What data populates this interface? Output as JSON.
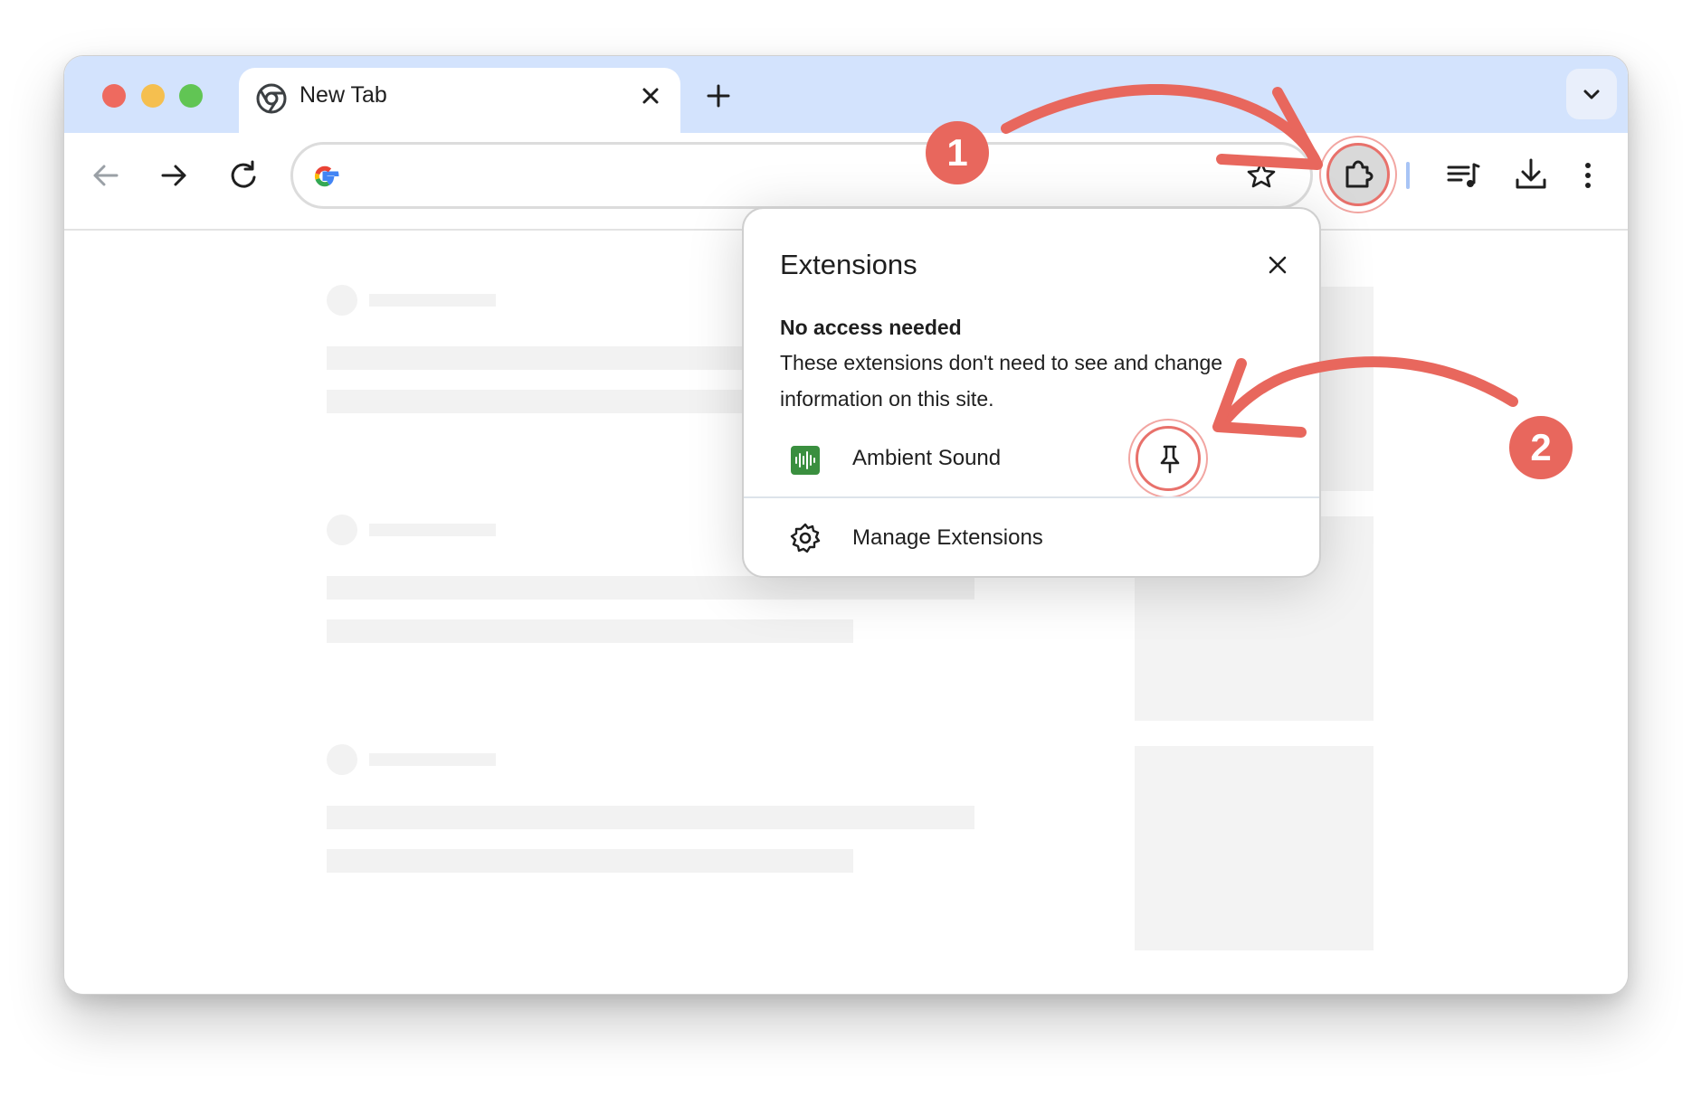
{
  "window": {
    "tab_title": "New Tab",
    "tab_icon": "chrome-icon"
  },
  "toolbar": {
    "back_icon": "arrow-left-icon",
    "forward_icon": "arrow-right-icon",
    "reload_icon": "reload-icon",
    "omnibox_icon": "google-g-icon",
    "bookmark_icon": "star-icon",
    "extensions_icon": "puzzle-piece-icon",
    "media_icon": "playlist-icon",
    "download_icon": "download-icon",
    "menu_icon": "kebab-menu-icon"
  },
  "popup": {
    "title": "Extensions",
    "section_heading": "No access needed",
    "section_description": "These extensions don't need to see and change information on this site.",
    "extensions": [
      {
        "name": "Ambient Sound",
        "icon": "audio-wave-icon",
        "icon_color": "#3a8f3f"
      }
    ],
    "manage_label": "Manage Extensions"
  },
  "annotations": {
    "step1": "1",
    "step2": "2",
    "accent_color": "#e8675d"
  }
}
